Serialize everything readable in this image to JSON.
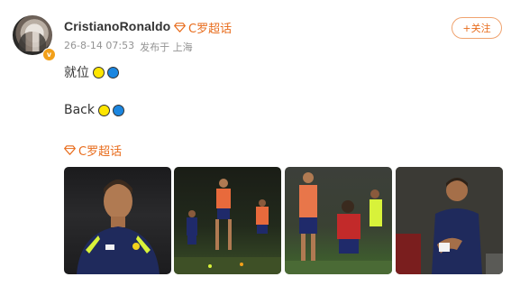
{
  "post": {
    "username": "CristianoRonaldo",
    "super_topic_label": "C罗超话",
    "time": "26-8-14 07:53",
    "posted_from": "发布于 上海",
    "follow_label": "+关注",
    "line1_text": "就位",
    "line2_text": "Back",
    "verified_badge": "v",
    "topic_tag_label": "C罗超话"
  },
  "icons": {
    "verified": "verified-badge-icon",
    "super_topic": "diamond-icon",
    "dot_colors": [
      "#ffe600",
      "#1b86e0"
    ]
  },
  "colors": {
    "accent": "#e86c1c",
    "badge": "#f2a01a"
  }
}
